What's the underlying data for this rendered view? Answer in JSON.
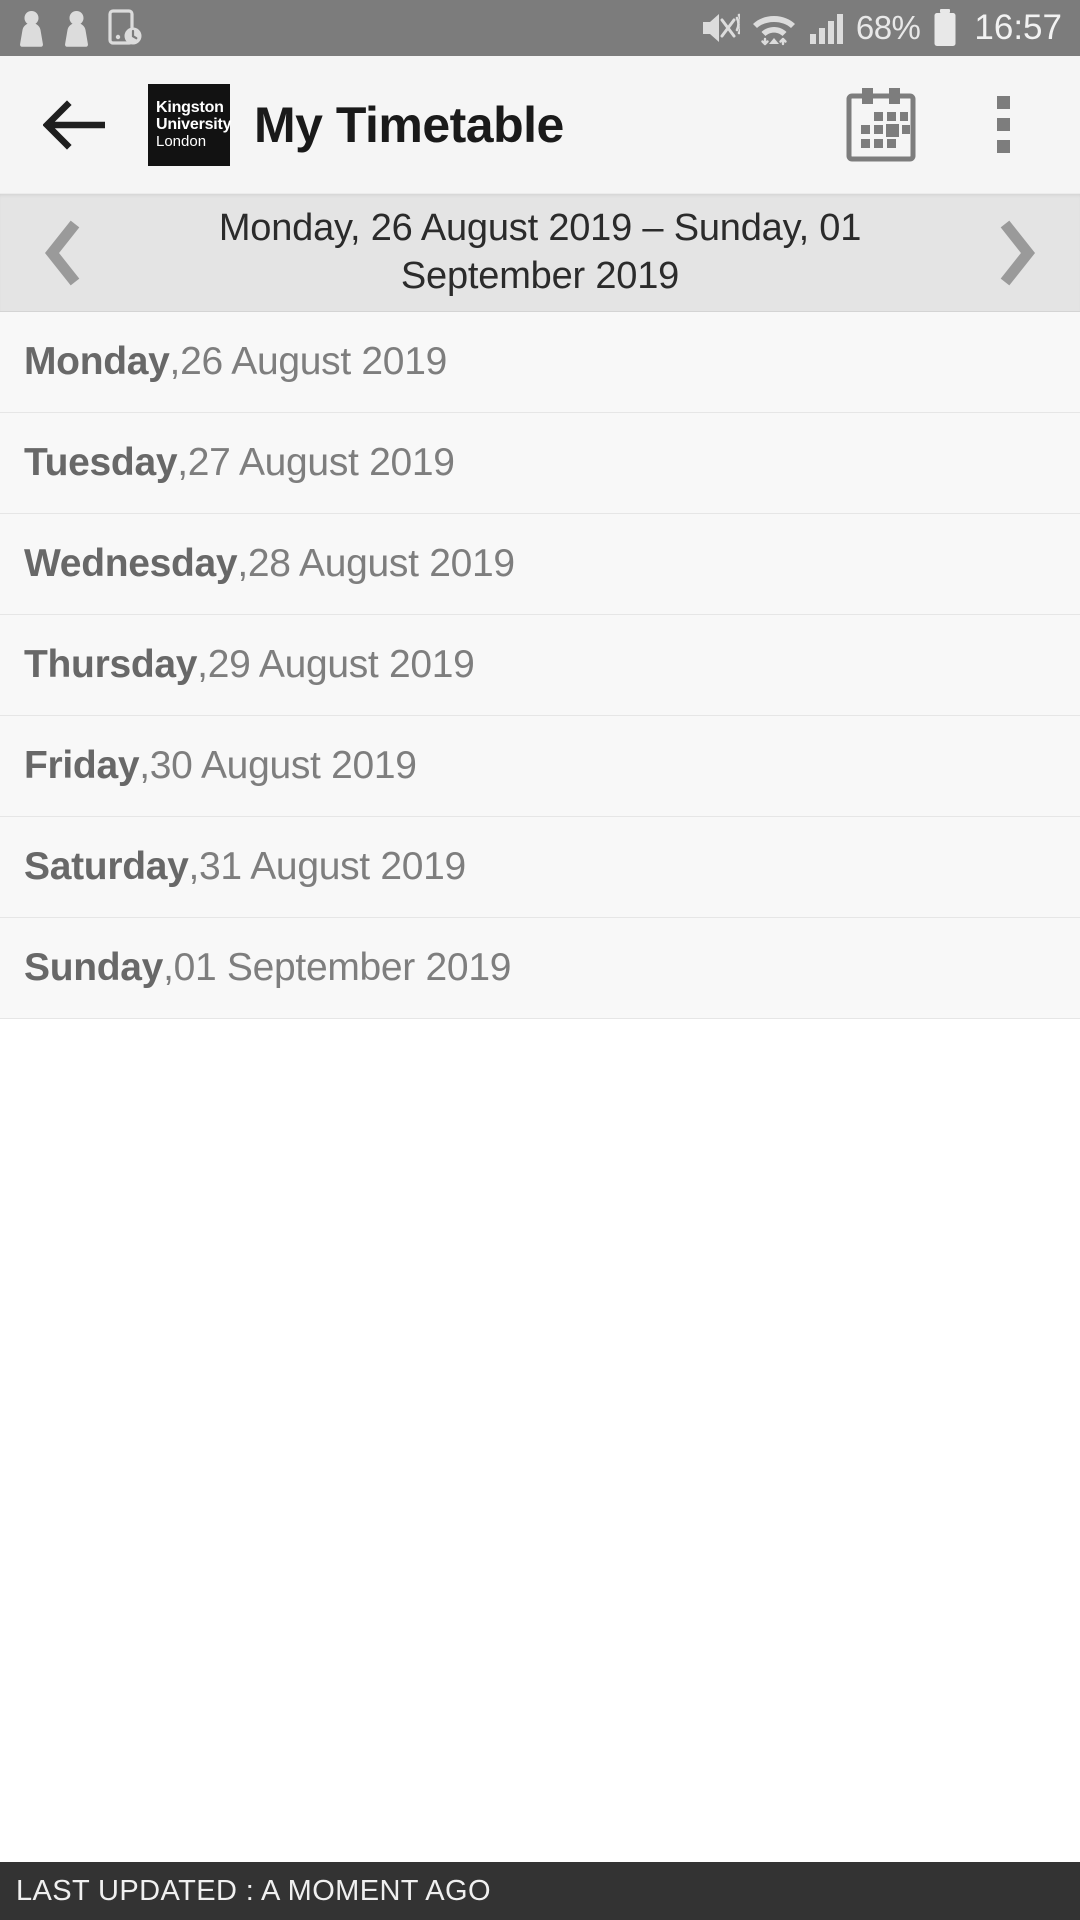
{
  "statusbar": {
    "icons": [
      "contact-icon",
      "contact-icon",
      "device-clock-icon",
      "mute-vibrate-icon",
      "wifi-icon",
      "signal-icon"
    ],
    "battery_text": "68%",
    "battery_icon": "battery-icon",
    "clock": "16:57"
  },
  "appbar": {
    "back_icon": "back-arrow-icon",
    "logo": {
      "line1": "Kingston",
      "line2": "University",
      "line3": "London"
    },
    "title": "My Timetable",
    "calendar_icon": "calendar-icon",
    "overflow_icon": "overflow-menu-icon"
  },
  "weeknav": {
    "prev_icon": "chevron-left-icon",
    "next_icon": "chevron-right-icon",
    "range_label": "Monday, 26 August 2019 – Sunday, 01 September 2019"
  },
  "days": [
    {
      "name": "Monday",
      "sep": ", ",
      "date": "26 August 2019"
    },
    {
      "name": "Tuesday",
      "sep": ", ",
      "date": "27 August 2019"
    },
    {
      "name": "Wednesday",
      "sep": ", ",
      "date": "28 August 2019"
    },
    {
      "name": "Thursday",
      "sep": ", ",
      "date": "29 August 2019"
    },
    {
      "name": "Friday",
      "sep": ", ",
      "date": "30 August 2019"
    },
    {
      "name": "Saturday",
      "sep": ", ",
      "date": "31 August 2019"
    },
    {
      "name": "Sunday",
      "sep": ", ",
      "date": "01 September 2019"
    }
  ],
  "footer": {
    "text": "LAST UPDATED : A MOMENT AGO"
  },
  "colors": {
    "statusbar_bg": "#7c7c7c",
    "appbar_bg": "#f5f5f5",
    "weeknav_bg": "#e4e4e4",
    "row_bg": "#f8f8f8",
    "footer_bg": "#333333",
    "logo_bg": "#121212",
    "dayname_text": "#686868",
    "daydate_text": "#7e7e7e"
  }
}
